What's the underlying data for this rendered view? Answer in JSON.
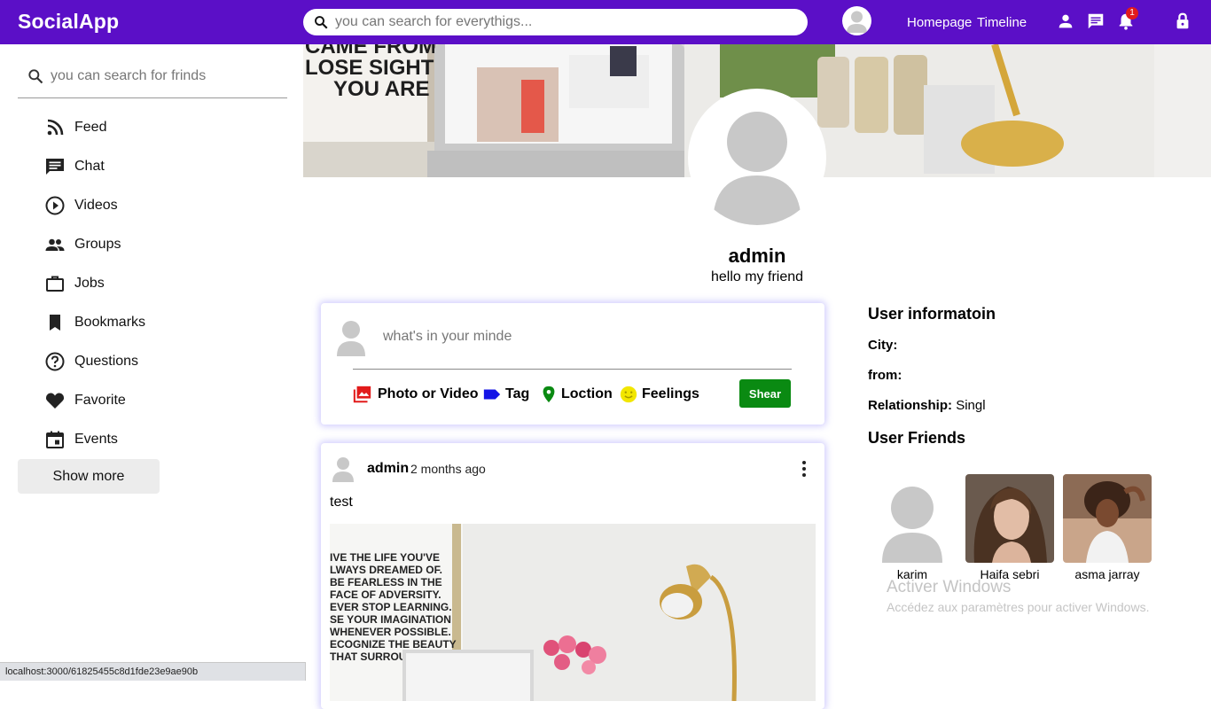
{
  "header": {
    "logo": "SocialApp",
    "search_placeholder": "you can search for everythigs...",
    "links": [
      "Homepage",
      "Timeline"
    ],
    "notification_count": "1",
    "color": "#5b0fc7"
  },
  "sidebar": {
    "search_placeholder": "you can search for frinds",
    "items": [
      {
        "label": "Feed",
        "icon": "rss-feed-icon"
      },
      {
        "label": "Chat",
        "icon": "chat-icon"
      },
      {
        "label": "Videos",
        "icon": "play-circle-icon"
      },
      {
        "label": "Groups",
        "icon": "group-icon"
      },
      {
        "label": "Jobs",
        "icon": "briefcase-icon"
      },
      {
        "label": "Bookmarks",
        "icon": "bookmark-icon"
      },
      {
        "label": "Questions",
        "icon": "help-circle-icon"
      },
      {
        "label": "Favorite",
        "icon": "heart-icon"
      },
      {
        "label": "Events",
        "icon": "calendar-icon"
      }
    ],
    "show_more": "Show more"
  },
  "cover": {
    "poster_text": [
      "CAME FROM, BU",
      "LOSE SIGHT OF",
      "YOU ARE GO"
    ]
  },
  "profile": {
    "name": "admin",
    "description": "hello my friend"
  },
  "share": {
    "placeholder": "what's in your minde",
    "options": [
      {
        "label": "Photo or Video",
        "color": "#e21b1b"
      },
      {
        "label": "Tag",
        "color": "#1414e6"
      },
      {
        "label": "Loction",
        "color": "#0a8a12"
      },
      {
        "label": "Feelings",
        "color": "#f2e600"
      }
    ],
    "button": "Shear"
  },
  "post": {
    "user": "admin",
    "date": "2 months ago",
    "text": "test",
    "poster_text": [
      "IVE THE LIFE YOU'VE",
      "LWAYS DREAMED OF.",
      "BE FEARLESS IN THE",
      "FACE OF ADVERSITY.",
      "EVER STOP LEARNING.",
      "SE YOUR IMAGINATION",
      "WHENEVER POSSIBLE.",
      "ECOGNIZE THE BEAUTY",
      "THAT SURROUND"
    ]
  },
  "user_info": {
    "title": "User informatoin",
    "city_label": "City:",
    "city": "",
    "from_label": "from:",
    "from": "",
    "relationship_label": "Relationship:",
    "relationship": "Singl"
  },
  "friends": {
    "title": "User Friends",
    "list": [
      {
        "name": "karim"
      },
      {
        "name": "Haifa sebri"
      },
      {
        "name": "asma jarray"
      }
    ]
  },
  "watermark": {
    "title": "Activer Windows",
    "subtitle": "Accédez aux paramètres pour activer Windows."
  },
  "statusbar": {
    "url": "localhost:3000/61825455c8d1fde23e9ae90b"
  }
}
